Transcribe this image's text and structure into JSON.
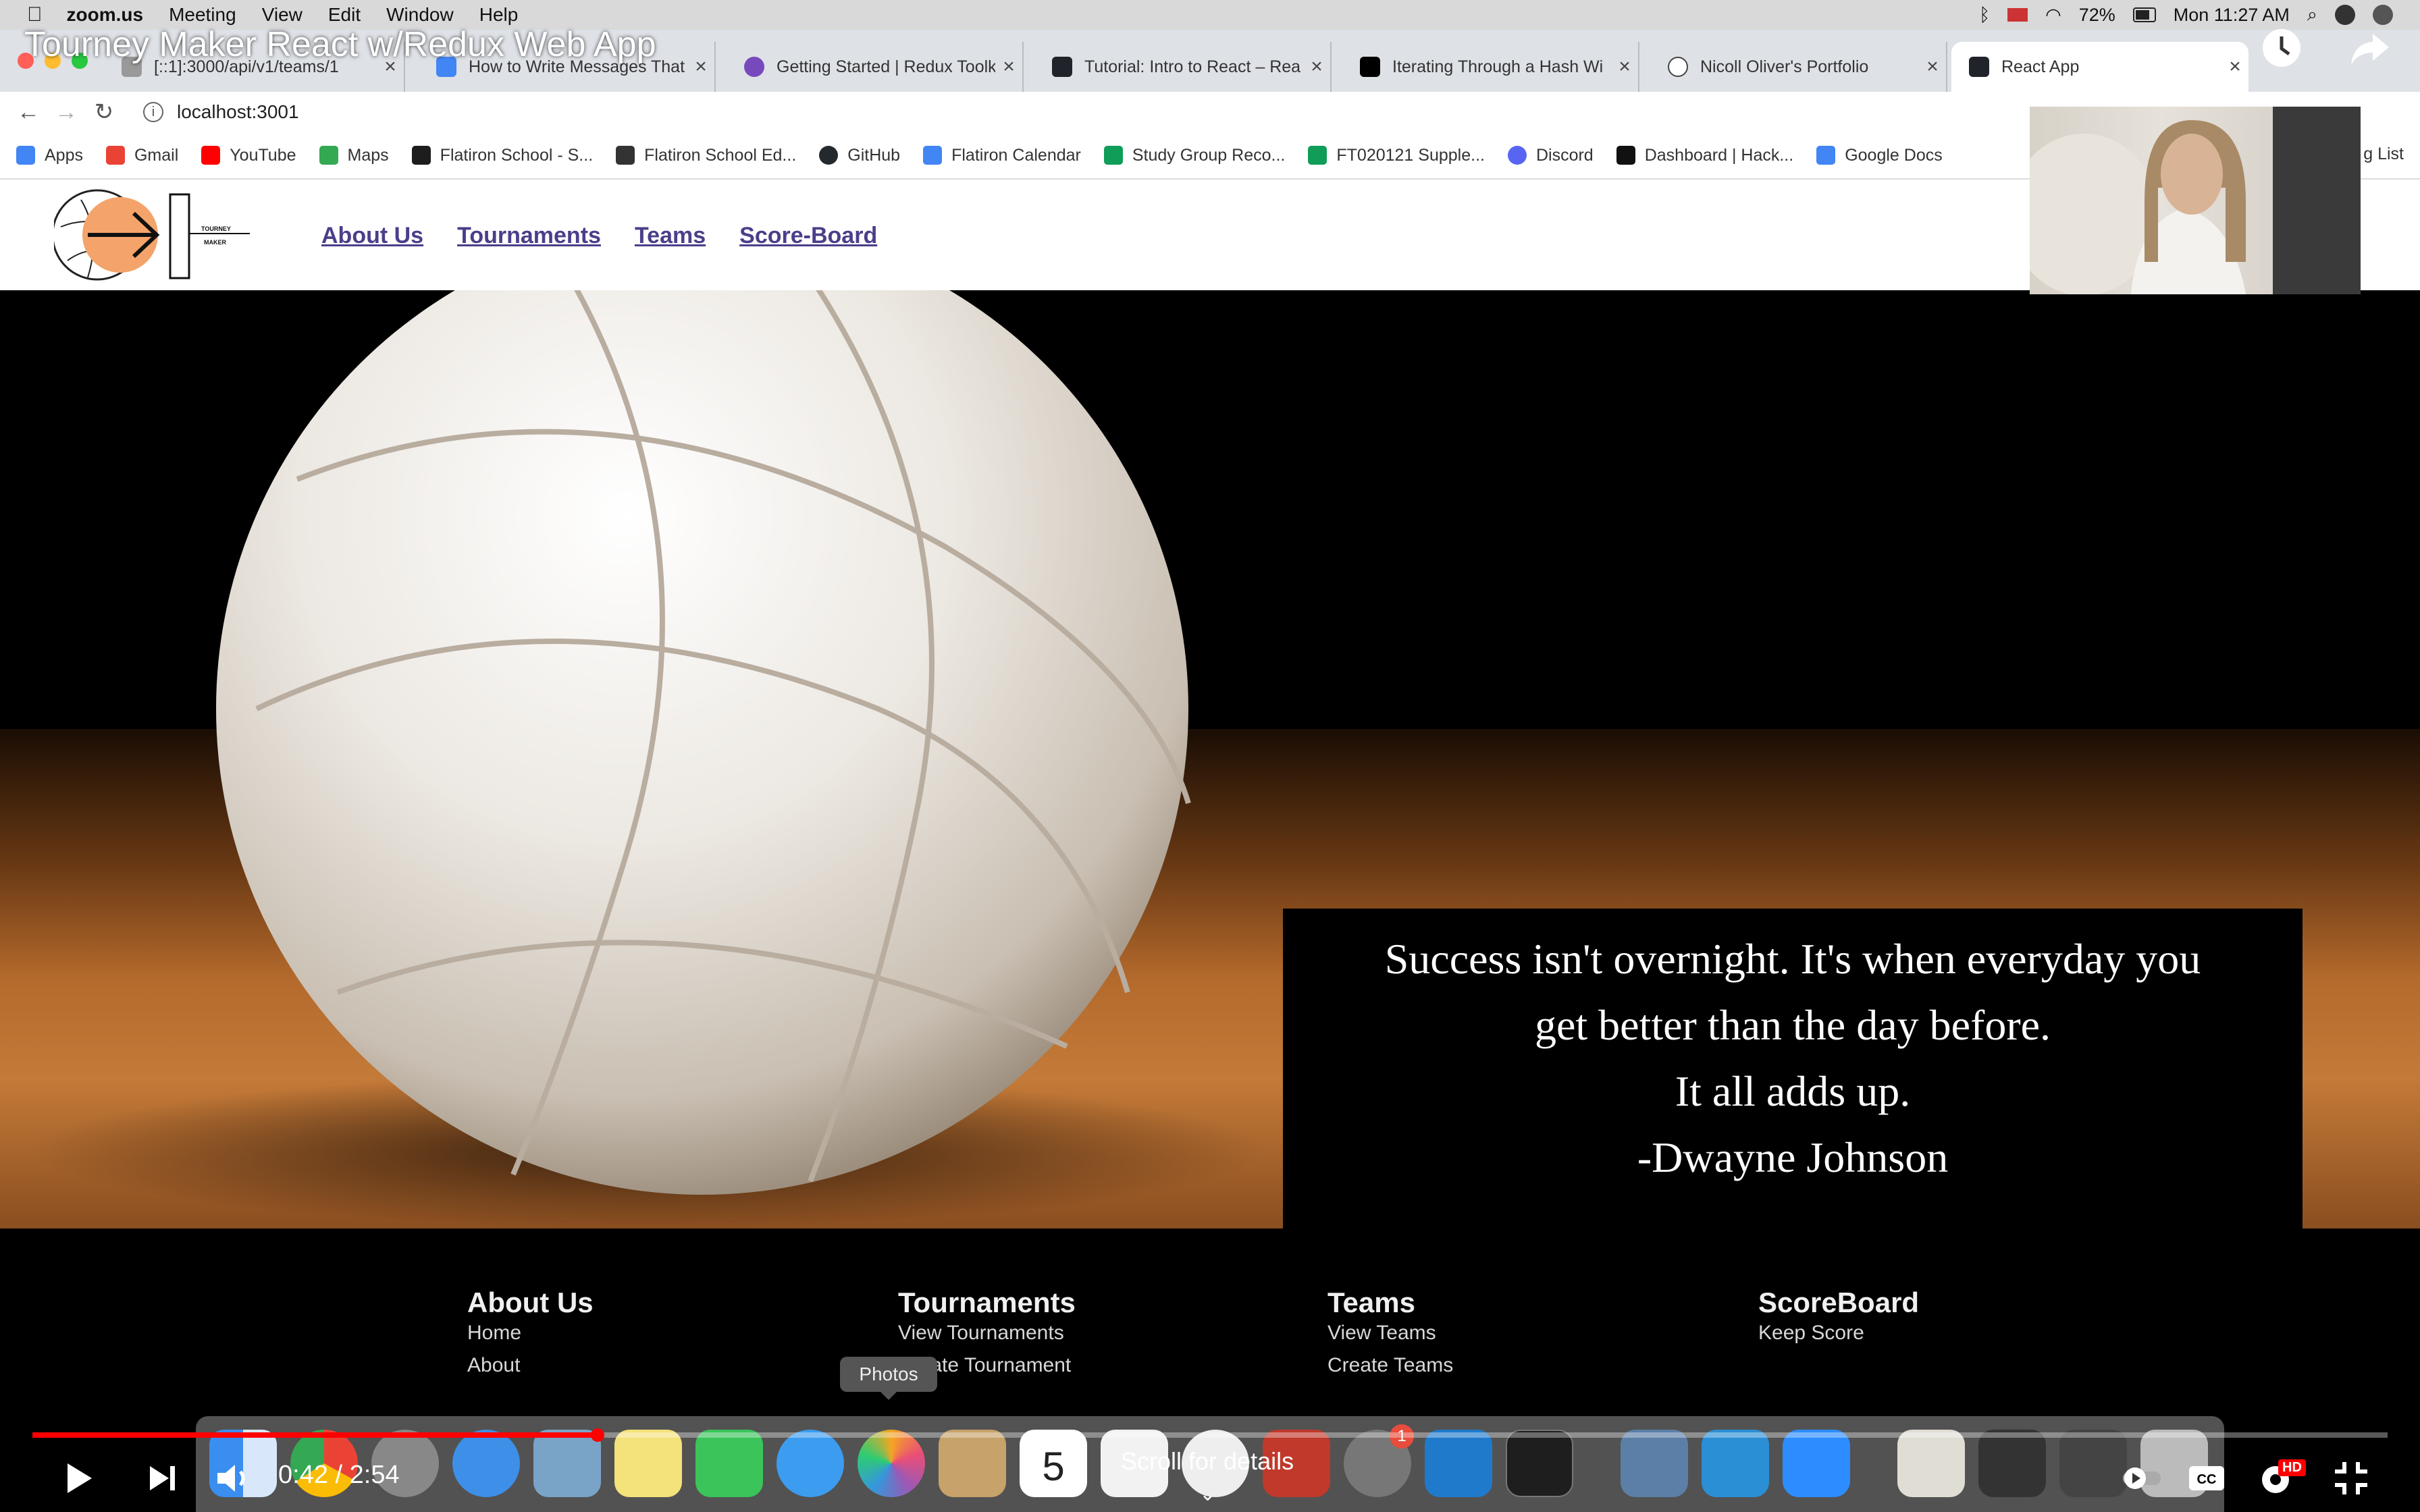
{
  "video": {
    "title": "Tourney Maker React w/Redux Web App",
    "time": "0:42 / 2:54",
    "progress": 0.24,
    "scroll_hint": "Scroll for details",
    "hd_badge": "HD"
  },
  "menubar": {
    "app": "zoom.us",
    "items": [
      "Meeting",
      "View",
      "Edit",
      "Window",
      "Help"
    ],
    "battery": "72%",
    "clock": "Mon 11:27 AM"
  },
  "browser": {
    "tabs": [
      {
        "label": "[::1]:3000/api/v1/teams/1",
        "icon": "page-icon"
      },
      {
        "label": "How to Write Messages That",
        "icon": "doc-icon"
      },
      {
        "label": "Getting Started | Redux Toolk",
        "icon": "redux-icon"
      },
      {
        "label": "Tutorial: Intro to React – Rea",
        "icon": "react-icon"
      },
      {
        "label": "Iterating Through a Hash Wi",
        "icon": "medium-icon"
      },
      {
        "label": "Nicoll Oliver's Portfolio",
        "icon": "globe-icon"
      },
      {
        "label": "React App",
        "icon": "react-icon"
      }
    ],
    "url": "localhost:3001",
    "bookmarks": [
      {
        "label": "Apps",
        "color": "#4285f4"
      },
      {
        "label": "Gmail",
        "color": "#ea4335"
      },
      {
        "label": "YouTube",
        "color": "#ff0000"
      },
      {
        "label": "Maps",
        "color": "#34a853"
      },
      {
        "label": "Flatiron School - S...",
        "color": "#1d1d1d"
      },
      {
        "label": "Flatiron School Ed...",
        "color": "#333333"
      },
      {
        "label": "GitHub",
        "color": "#24292e"
      },
      {
        "label": "Flatiron Calendar",
        "color": "#4285f4"
      },
      {
        "label": "Study Group Reco...",
        "color": "#0f9d58"
      },
      {
        "label": "FT020121 Supple...",
        "color": "#0f9d58"
      },
      {
        "label": "Discord",
        "color": "#5865f2"
      },
      {
        "label": "Dashboard | Hack...",
        "color": "#111111"
      },
      {
        "label": "Google Docs",
        "color": "#4285f4"
      }
    ],
    "reading_list": "g List"
  },
  "site": {
    "logo_text": "TOURNEY MAKER",
    "nav": [
      "About Us",
      "Tournaments",
      "Teams",
      "Score-Board"
    ],
    "quote": {
      "line1": "Success isn't overnight. It's when everyday you",
      "line2": "get better than the day before.",
      "line3": "It all adds up.",
      "author": "-Dwayne Johnson"
    },
    "footer": [
      {
        "heading": "About Us",
        "links": [
          "Home",
          "About"
        ]
      },
      {
        "heading": "Tournaments",
        "links": [
          "View Tournaments",
          "Create Tournament"
        ]
      },
      {
        "heading": "Teams",
        "links": [
          "View Teams",
          "Create Teams"
        ]
      },
      {
        "heading": "ScoreBoard",
        "links": [
          "Keep Score"
        ]
      }
    ]
  },
  "dock": {
    "tooltip": "Photos",
    "calendar_day": "5",
    "badge": "1"
  }
}
